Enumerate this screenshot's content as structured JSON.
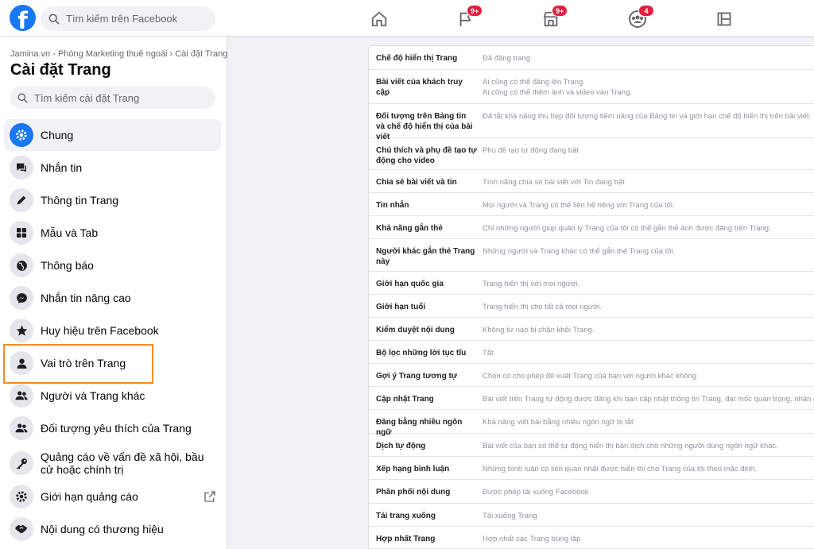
{
  "topbar": {
    "logo": "f",
    "search_placeholder": "Tìm kiếm trên Facebook",
    "nav": [
      {
        "icon": "home-icon",
        "badge": ""
      },
      {
        "icon": "flag-icon",
        "badge": "9+"
      },
      {
        "icon": "marketplace-icon",
        "badge": "9+"
      },
      {
        "icon": "groups-icon",
        "badge": "4"
      },
      {
        "icon": "gaming-icon",
        "badge": ""
      }
    ]
  },
  "sidebar": {
    "breadcrumb": "Jamina.vn - Phòng Marketing thuê ngoài › Cài đặt Trang",
    "title": "Cài đặt Trang",
    "search_placeholder": "Tìm kiếm cài đặt Trang",
    "items": [
      {
        "label": "Chung",
        "icon": "gear-icon",
        "active": true
      },
      {
        "label": "Nhắn tin",
        "icon": "chat-icon"
      },
      {
        "label": "Thông tin Trang",
        "icon": "pencil-icon"
      },
      {
        "label": "Mẫu và Tab",
        "icon": "grid-icon"
      },
      {
        "label": "Thông báo",
        "icon": "globe-icon"
      },
      {
        "label": "Nhắn tin nâng cao",
        "icon": "messenger-icon"
      },
      {
        "label": "Huy hiệu trên Facebook",
        "icon": "badge-icon"
      },
      {
        "label": "Vai trò trên Trang",
        "icon": "person-icon"
      },
      {
        "label": "Người và Trang khác",
        "icon": "people-icon"
      },
      {
        "label": "Đối tượng yêu thích của Trang",
        "icon": "people-icon"
      },
      {
        "label": "Quảng cáo về vấn đề xã hội, bầu cử hoặc chính trị",
        "icon": "key-icon"
      },
      {
        "label": "Giới hạn quảng cáo",
        "icon": "gear-icon",
        "external": true
      },
      {
        "label": "Nội dung có thương hiệu",
        "icon": "handshake-icon"
      }
    ],
    "highlight_color": "#f28c28"
  },
  "settings": [
    {
      "label": "Chế độ hiển thị Trang",
      "value": "Đã đăng trang"
    },
    {
      "label": "Bài viết của khách truy cập",
      "value": "Ai cũng có thể đăng lên Trang.",
      "value2": "Ai cũng có thể thêm ảnh và video vào Trang."
    },
    {
      "label": "Đối tượng trên Bảng tin và chế độ hiển thị của bài viết",
      "value": "Đã tắt khả năng thu hẹp đối tượng tiềm năng của Bảng tin và giới hạn chế độ hiển thị trên bài viết."
    },
    {
      "label": "Chú thích và phụ đề tạo tự động cho video",
      "value": "Phụ đề tạo tự động đang bật"
    },
    {
      "label": "Chia sẻ bài viết và tin",
      "value": "Tính năng chia sẻ bài viết với Tin đang bật"
    },
    {
      "label": "Tin nhắn",
      "value": "Mọi người và Trang có thể liên hệ riêng với Trang của tôi."
    },
    {
      "label": "Khả năng gắn thẻ",
      "value": "Chỉ những người giúp quản lý Trang của tôi có thể gắn thẻ ảnh được đăng trên Trang."
    },
    {
      "label": "Người khác gắn thẻ Trang này",
      "value": "Những người và Trang khác có thể gắn thẻ Trang của tôi."
    },
    {
      "label": "Giới hạn quốc gia",
      "value": "Trang hiển thị với mọi người."
    },
    {
      "label": "Giới hạn tuổi",
      "value": "Trang hiển thị cho tất cả mọi người."
    },
    {
      "label": "Kiểm duyệt nội dung",
      "value": "Không từ nào bị chặn khỏi Trang."
    },
    {
      "label": "Bộ lọc những lời tục tĩu",
      "value": "Tắt"
    },
    {
      "label": "Gợi ý Trang tương tự",
      "value": "Chọn có cho phép đề xuất Trang của bạn với người khác không"
    },
    {
      "label": "Cập nhật Trang",
      "value": "Bài viết trên Trang tự động được đăng khi bạn cập nhật thông tin Trang, đạt mốc quan trọng, nhận đánh giá"
    },
    {
      "label": "Đăng bằng nhiều ngôn ngữ",
      "value": "Khả năng viết bài bằng nhiều ngôn ngữ bị tắt"
    },
    {
      "label": "Dịch tự động",
      "value": "Bài viết của bạn có thể tự động hiển thị bản dịch cho những người dùng ngôn ngữ khác."
    },
    {
      "label": "Xếp hạng bình luận",
      "value": "Những bình luận có liên quan nhất được hiển thị cho Trang của tôi theo mặc định."
    },
    {
      "label": "Phân phối nội dung",
      "value": "Được phép tải xuống Facebook"
    },
    {
      "label": "Tải trang xuống",
      "value": "Tải xuống Trang"
    },
    {
      "label": "Hợp nhất Trang",
      "value": "Hợp nhất các Trang trùng lặp"
    }
  ]
}
